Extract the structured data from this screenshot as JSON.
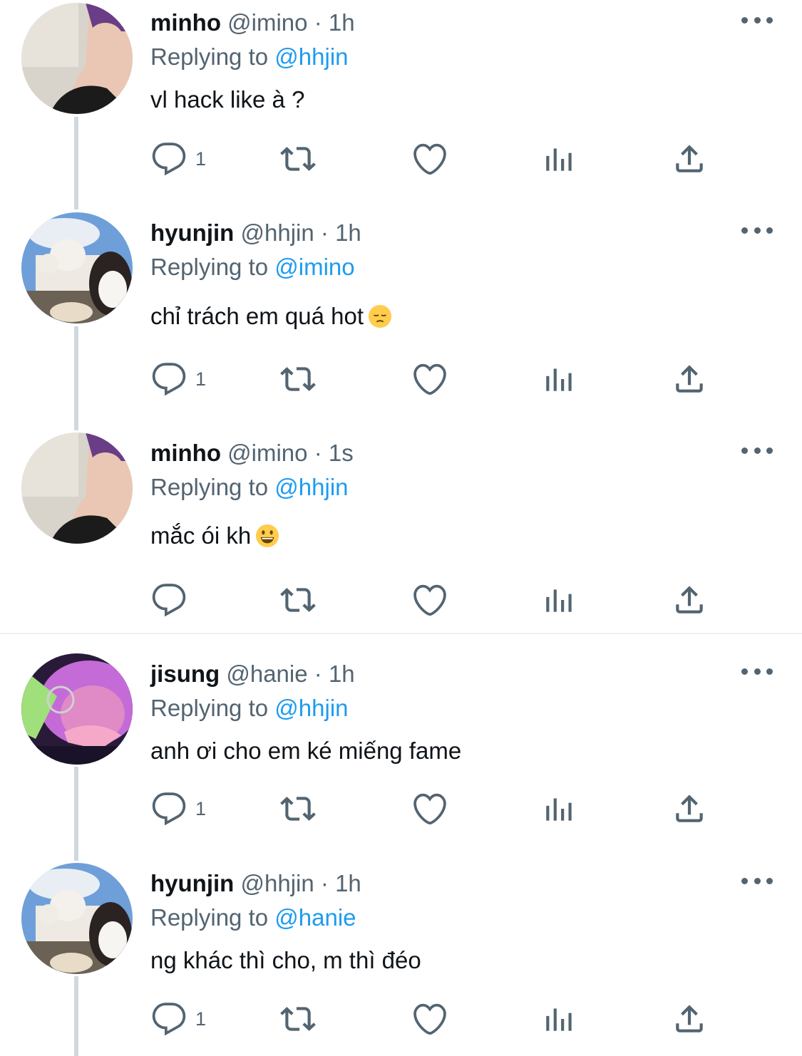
{
  "tweets": [
    {
      "name": "minho",
      "handle": "@imino",
      "dot": "·",
      "time": "1h",
      "replying_label": "Replying to",
      "replying_to": "@hhjin",
      "text": "vl hack like à ?",
      "reply_count": "1",
      "avatar": "avatar-minho"
    },
    {
      "name": "hyunjin",
      "handle": "@hhjin",
      "dot": "·",
      "time": "1h",
      "replying_label": "Replying to",
      "replying_to": "@imino",
      "text": "chỉ trách em quá hot",
      "emoji": "pensive-face",
      "reply_count": "1",
      "avatar": "avatar-hyunjin"
    },
    {
      "name": "minho",
      "handle": "@imino",
      "dot": "·",
      "time": "1s",
      "replying_label": "Replying to",
      "replying_to": "@hhjin",
      "text": "mắc ói kh",
      "emoji": "grinning-face",
      "reply_count": "",
      "avatar": "avatar-minho"
    },
    {
      "name": "jisung",
      "handle": "@hanie",
      "dot": "·",
      "time": "1h",
      "replying_label": "Replying to",
      "replying_to": "@hhjin",
      "text": "anh ơi cho em ké miếng fame",
      "reply_count": "1",
      "avatar": "avatar-jisung"
    },
    {
      "name": "hyunjin",
      "handle": "@hhjin",
      "dot": "·",
      "time": "1h",
      "replying_label": "Replying to",
      "replying_to": "@hanie",
      "text": "ng khác thì cho, m thì đéo",
      "reply_count": "1",
      "avatar": "avatar-hyunjin"
    }
  ],
  "icons": [
    "reply-icon",
    "retweet-icon",
    "like-icon",
    "views-icon",
    "share-icon",
    "more-icon"
  ],
  "colors": {
    "accent": "#1d9bf0",
    "secondary": "#536471",
    "thread_line": "#cfd9de"
  }
}
